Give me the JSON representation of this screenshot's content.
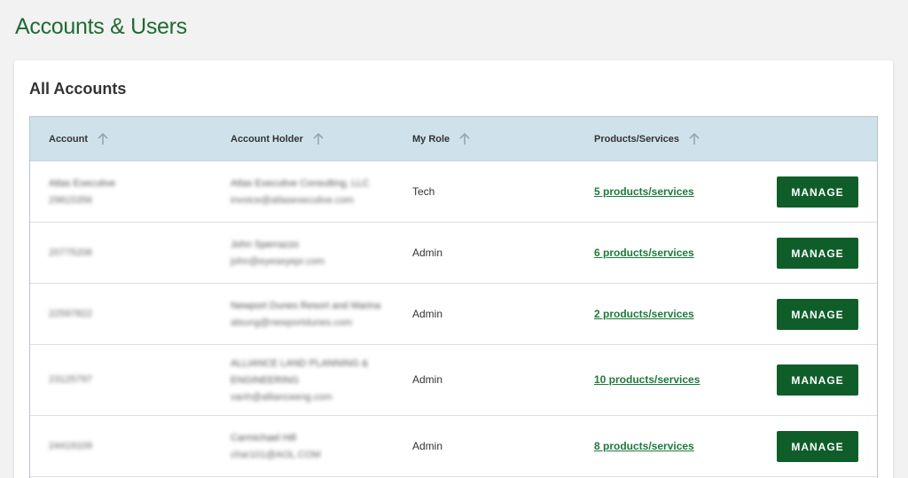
{
  "page_title": "Accounts & Users",
  "card_title": "All Accounts",
  "columns": [
    {
      "label": "Account"
    },
    {
      "label": "Account Holder"
    },
    {
      "label": "My Role"
    },
    {
      "label": "Products/Services"
    }
  ],
  "manage_label": "MANAGE",
  "rows": [
    {
      "account_name": "Atlas Executive",
      "account_number": "29815356",
      "holder_name": "Atlas Executive Consulting, LLC",
      "holder_email": "invoice@atlasexecutive.com",
      "role": "Tech",
      "products": "5 products/services"
    },
    {
      "account_name": "",
      "account_number": "20775206",
      "holder_name": "John Sperrazzo",
      "holder_email": "john@eyeseyepr.com",
      "role": "Admin",
      "products": "6 products/services"
    },
    {
      "account_name": "",
      "account_number": "22597822",
      "holder_name": "Newport Dunes Resort and Marina",
      "holder_email": "atsung@newportdunes.com",
      "role": "Admin",
      "products": "2 products/services"
    },
    {
      "account_name": "",
      "account_number": "23125797",
      "holder_name": "ALLIANCE LAND PLANNING & ENGINEERING",
      "holder_email": "vanh@allianceeng.com",
      "role": "Admin",
      "products": "10 products/services"
    },
    {
      "account_name": "",
      "account_number": "24419109",
      "holder_name": "Carmichael Hill",
      "holder_email": "char101@AOL.COM",
      "role": "Admin",
      "products": "8 products/services"
    }
  ]
}
